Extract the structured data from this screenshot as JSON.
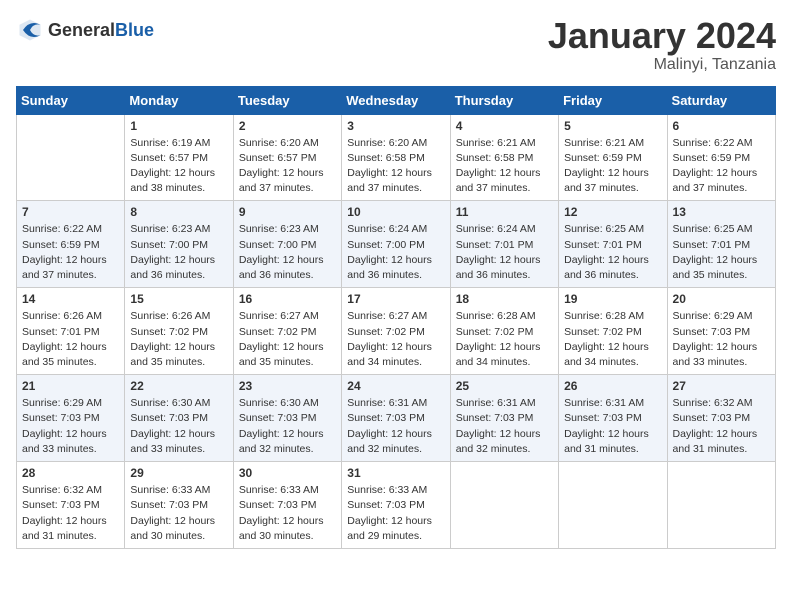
{
  "header": {
    "logo_general": "General",
    "logo_blue": "Blue",
    "month_title": "January 2024",
    "location": "Malinyi, Tanzania"
  },
  "weekdays": [
    "Sunday",
    "Monday",
    "Tuesday",
    "Wednesday",
    "Thursday",
    "Friday",
    "Saturday"
  ],
  "weeks": [
    [
      {
        "day": "",
        "sunrise": "",
        "sunset": "",
        "daylight": ""
      },
      {
        "day": "1",
        "sunrise": "Sunrise: 6:19 AM",
        "sunset": "Sunset: 6:57 PM",
        "daylight": "Daylight: 12 hours and 38 minutes."
      },
      {
        "day": "2",
        "sunrise": "Sunrise: 6:20 AM",
        "sunset": "Sunset: 6:57 PM",
        "daylight": "Daylight: 12 hours and 37 minutes."
      },
      {
        "day": "3",
        "sunrise": "Sunrise: 6:20 AM",
        "sunset": "Sunset: 6:58 PM",
        "daylight": "Daylight: 12 hours and 37 minutes."
      },
      {
        "day": "4",
        "sunrise": "Sunrise: 6:21 AM",
        "sunset": "Sunset: 6:58 PM",
        "daylight": "Daylight: 12 hours and 37 minutes."
      },
      {
        "day": "5",
        "sunrise": "Sunrise: 6:21 AM",
        "sunset": "Sunset: 6:59 PM",
        "daylight": "Daylight: 12 hours and 37 minutes."
      },
      {
        "day": "6",
        "sunrise": "Sunrise: 6:22 AM",
        "sunset": "Sunset: 6:59 PM",
        "daylight": "Daylight: 12 hours and 37 minutes."
      }
    ],
    [
      {
        "day": "7",
        "sunrise": "Sunrise: 6:22 AM",
        "sunset": "Sunset: 6:59 PM",
        "daylight": "Daylight: 12 hours and 37 minutes."
      },
      {
        "day": "8",
        "sunrise": "Sunrise: 6:23 AM",
        "sunset": "Sunset: 7:00 PM",
        "daylight": "Daylight: 12 hours and 36 minutes."
      },
      {
        "day": "9",
        "sunrise": "Sunrise: 6:23 AM",
        "sunset": "Sunset: 7:00 PM",
        "daylight": "Daylight: 12 hours and 36 minutes."
      },
      {
        "day": "10",
        "sunrise": "Sunrise: 6:24 AM",
        "sunset": "Sunset: 7:00 PM",
        "daylight": "Daylight: 12 hours and 36 minutes."
      },
      {
        "day": "11",
        "sunrise": "Sunrise: 6:24 AM",
        "sunset": "Sunset: 7:01 PM",
        "daylight": "Daylight: 12 hours and 36 minutes."
      },
      {
        "day": "12",
        "sunrise": "Sunrise: 6:25 AM",
        "sunset": "Sunset: 7:01 PM",
        "daylight": "Daylight: 12 hours and 36 minutes."
      },
      {
        "day": "13",
        "sunrise": "Sunrise: 6:25 AM",
        "sunset": "Sunset: 7:01 PM",
        "daylight": "Daylight: 12 hours and 35 minutes."
      }
    ],
    [
      {
        "day": "14",
        "sunrise": "Sunrise: 6:26 AM",
        "sunset": "Sunset: 7:01 PM",
        "daylight": "Daylight: 12 hours and 35 minutes."
      },
      {
        "day": "15",
        "sunrise": "Sunrise: 6:26 AM",
        "sunset": "Sunset: 7:02 PM",
        "daylight": "Daylight: 12 hours and 35 minutes."
      },
      {
        "day": "16",
        "sunrise": "Sunrise: 6:27 AM",
        "sunset": "Sunset: 7:02 PM",
        "daylight": "Daylight: 12 hours and 35 minutes."
      },
      {
        "day": "17",
        "sunrise": "Sunrise: 6:27 AM",
        "sunset": "Sunset: 7:02 PM",
        "daylight": "Daylight: 12 hours and 34 minutes."
      },
      {
        "day": "18",
        "sunrise": "Sunrise: 6:28 AM",
        "sunset": "Sunset: 7:02 PM",
        "daylight": "Daylight: 12 hours and 34 minutes."
      },
      {
        "day": "19",
        "sunrise": "Sunrise: 6:28 AM",
        "sunset": "Sunset: 7:02 PM",
        "daylight": "Daylight: 12 hours and 34 minutes."
      },
      {
        "day": "20",
        "sunrise": "Sunrise: 6:29 AM",
        "sunset": "Sunset: 7:03 PM",
        "daylight": "Daylight: 12 hours and 33 minutes."
      }
    ],
    [
      {
        "day": "21",
        "sunrise": "Sunrise: 6:29 AM",
        "sunset": "Sunset: 7:03 PM",
        "daylight": "Daylight: 12 hours and 33 minutes."
      },
      {
        "day": "22",
        "sunrise": "Sunrise: 6:30 AM",
        "sunset": "Sunset: 7:03 PM",
        "daylight": "Daylight: 12 hours and 33 minutes."
      },
      {
        "day": "23",
        "sunrise": "Sunrise: 6:30 AM",
        "sunset": "Sunset: 7:03 PM",
        "daylight": "Daylight: 12 hours and 32 minutes."
      },
      {
        "day": "24",
        "sunrise": "Sunrise: 6:31 AM",
        "sunset": "Sunset: 7:03 PM",
        "daylight": "Daylight: 12 hours and 32 minutes."
      },
      {
        "day": "25",
        "sunrise": "Sunrise: 6:31 AM",
        "sunset": "Sunset: 7:03 PM",
        "daylight": "Daylight: 12 hours and 32 minutes."
      },
      {
        "day": "26",
        "sunrise": "Sunrise: 6:31 AM",
        "sunset": "Sunset: 7:03 PM",
        "daylight": "Daylight: 12 hours and 31 minutes."
      },
      {
        "day": "27",
        "sunrise": "Sunrise: 6:32 AM",
        "sunset": "Sunset: 7:03 PM",
        "daylight": "Daylight: 12 hours and 31 minutes."
      }
    ],
    [
      {
        "day": "28",
        "sunrise": "Sunrise: 6:32 AM",
        "sunset": "Sunset: 7:03 PM",
        "daylight": "Daylight: 12 hours and 31 minutes."
      },
      {
        "day": "29",
        "sunrise": "Sunrise: 6:33 AM",
        "sunset": "Sunset: 7:03 PM",
        "daylight": "Daylight: 12 hours and 30 minutes."
      },
      {
        "day": "30",
        "sunrise": "Sunrise: 6:33 AM",
        "sunset": "Sunset: 7:03 PM",
        "daylight": "Daylight: 12 hours and 30 minutes."
      },
      {
        "day": "31",
        "sunrise": "Sunrise: 6:33 AM",
        "sunset": "Sunset: 7:03 PM",
        "daylight": "Daylight: 12 hours and 29 minutes."
      },
      {
        "day": "",
        "sunrise": "",
        "sunset": "",
        "daylight": ""
      },
      {
        "day": "",
        "sunrise": "",
        "sunset": "",
        "daylight": ""
      },
      {
        "day": "",
        "sunrise": "",
        "sunset": "",
        "daylight": ""
      }
    ]
  ]
}
